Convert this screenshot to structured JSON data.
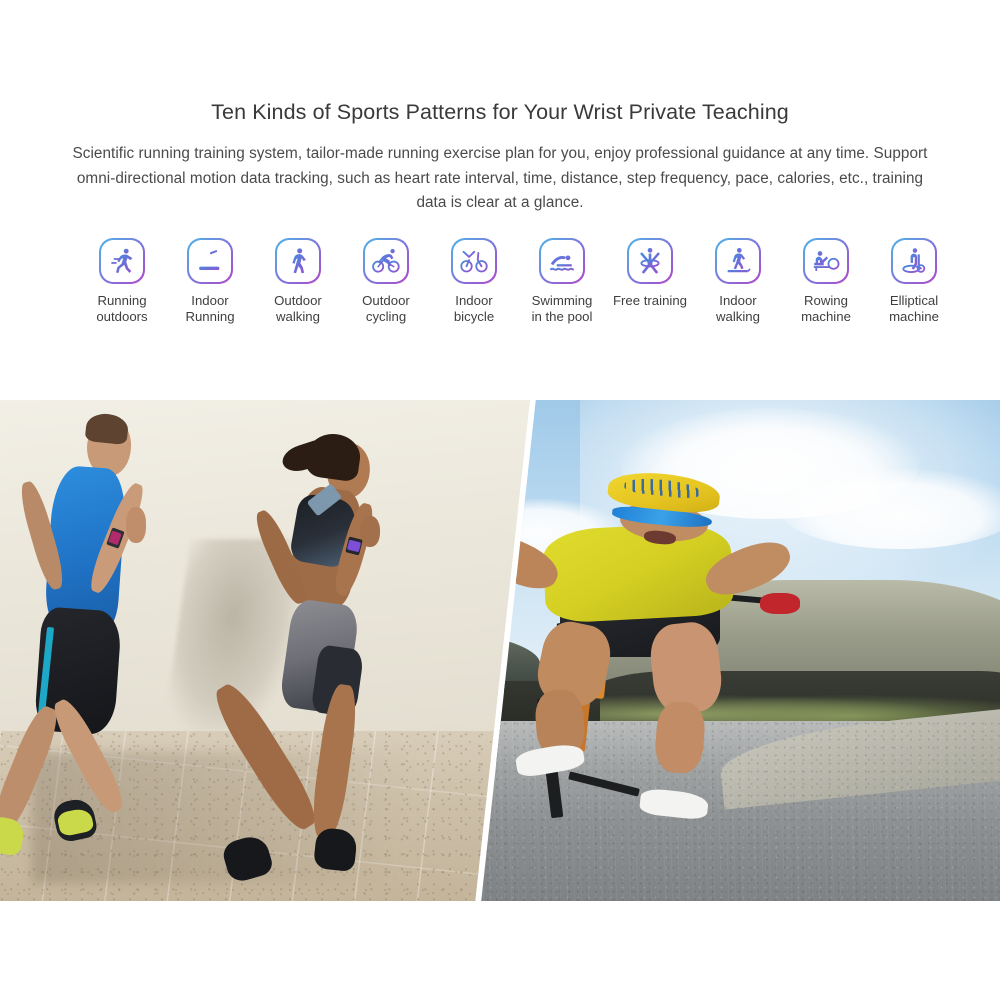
{
  "headline": "Ten Kinds of Sports Patterns for Your Wrist Private Teaching",
  "subcopy": "Scientific running training system, tailor-made running exercise plan for you, enjoy professional guidance at any time. Support omni-directional motion data tracking, such as heart rate interval, time, distance, step frequency, pace, calories, etc., training data is clear at a glance.",
  "colors": {
    "gradient_start": "#4fb6e8",
    "gradient_mid": "#7a7ddc",
    "gradient_end": "#b047c8",
    "headline_text": "#3a3a3a",
    "body_text": "#4a4a4a",
    "label_text": "#3f3f3f",
    "page_background": "#ffffff"
  },
  "sports": [
    {
      "icon": "running-outdoors-icon",
      "label": "Running\noutdoors"
    },
    {
      "icon": "indoor-running-treadmill-icon",
      "label": "Indoor\nRunning"
    },
    {
      "icon": "outdoor-walking-icon",
      "label": "Outdoor\nwalking"
    },
    {
      "icon": "outdoor-cycling-icon",
      "label": "Outdoor\ncycling"
    },
    {
      "icon": "indoor-bicycle-icon",
      "label": "Indoor\nbicycle"
    },
    {
      "icon": "swimming-pool-icon",
      "label": "Swimming\nin the pool"
    },
    {
      "icon": "free-training-icon",
      "label": "Free training"
    },
    {
      "icon": "indoor-walking-icon",
      "label": "Indoor\nwalking"
    },
    {
      "icon": "rowing-machine-icon",
      "label": "Rowing\nmachine"
    },
    {
      "icon": "elliptical-machine-icon",
      "label": "Elliptical\nmachine"
    }
  ],
  "photos": [
    {
      "name": "runners-photo",
      "alt": "Man in blue tank top and woman in grey shorts running outdoors beside a cream wall on a paved path, both wearing fitness trackers"
    },
    {
      "name": "cyclist-photo",
      "alt": "Cyclist in yellow jersey and yellow helmet riding a road bike on a coastal road with ocean and cliffs behind"
    }
  ]
}
